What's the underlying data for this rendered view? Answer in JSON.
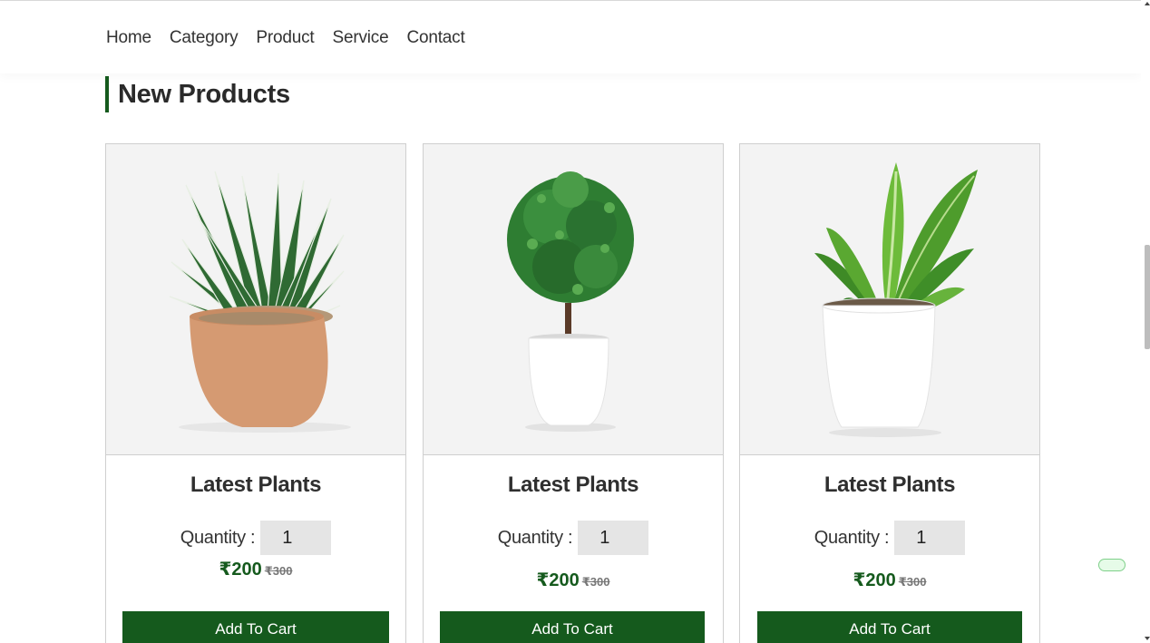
{
  "nav": {
    "items": [
      {
        "label": "Home"
      },
      {
        "label": "Category"
      },
      {
        "label": "Product"
      },
      {
        "label": "Service"
      },
      {
        "label": "Contact"
      }
    ]
  },
  "section": {
    "title": "New Products"
  },
  "products": [
    {
      "name": "Latest Plants",
      "quantity_label": "Quantity :",
      "quantity": "1",
      "price": "₹200",
      "old_price": "₹300",
      "button": "Add To Cart",
      "image_icon": "succulent-terracotta-pot"
    },
    {
      "name": "Latest Plants",
      "quantity_label": "Quantity :",
      "quantity": "1",
      "price": "₹200",
      "old_price": "₹300",
      "button": "Add To Cart",
      "image_icon": "topiary-ball-white-pot"
    },
    {
      "name": "Latest Plants",
      "quantity_label": "Quantity :",
      "quantity": "1",
      "price": "₹200",
      "old_price": "₹300",
      "button": "Add To Cart",
      "image_icon": "dieffenbachia-white-pot"
    }
  ],
  "colors": {
    "accent": "#155a1d",
    "card_border": "#cfcfcf",
    "image_bg": "#f3f3f3",
    "input_bg": "#e5e5e5"
  }
}
